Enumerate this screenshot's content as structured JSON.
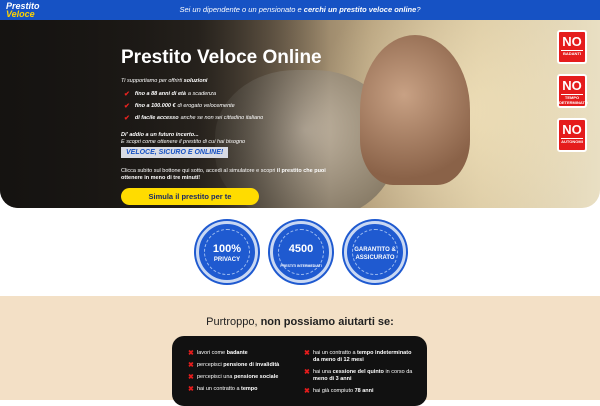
{
  "topbar": {
    "logo_line1": "Prestito",
    "logo_line2": "Veloce",
    "pre": "Sei un dipendente o un pensionato e ",
    "bold": "cerchi un prestito veloce online",
    "post": "?"
  },
  "hero": {
    "title": "Prestito Veloce Online",
    "intro_pre": "Ti supportiamo per offrirti ",
    "intro_bold": "soluzioni",
    "items": [
      {
        "bold": "fino a 88 anni di età",
        "rest": "a scadenza"
      },
      {
        "bold": "fino a 100.000 €",
        "rest": "di erogato velocemente"
      },
      {
        "bold": "di facile accesso",
        "rest": "anche se non sei cittadino italiano"
      }
    ],
    "question": "Di' addio a un futuro incerto...",
    "question2": "E scopri come ottenere il prestito di cui hai bisogno",
    "tagline": "VELOCE, SICURO E ONLINE!",
    "para_pre": "Clicca subito sul bottone qui sotto, accedi al simulatore e scopri ",
    "para_bold": "il prestito che puoi ottenere in meno di tre minuti!",
    "cta_pre": "Simula ",
    "cta_bold": "il prestito per te",
    "scroll_icon": "chevron-down-icon"
  },
  "side_badges": [
    {
      "big": "NO",
      "small": "BADANTI"
    },
    {
      "big": "NO",
      "small": "TEMPO DETERMINATO"
    },
    {
      "big": "NO",
      "small": "AUTONOMI"
    }
  ],
  "seals": [
    {
      "line1": "100%",
      "line2": "PRIVACY"
    },
    {
      "line1": "4500",
      "line2": "PRESTITI INTERMEDIATI"
    },
    {
      "line1": "GARANTITO & ASSICURATO"
    }
  ],
  "lower": {
    "title_pre": "Purtroppo, ",
    "title_bold": "non possiamo aiutarti se:",
    "left": [
      {
        "pre": "lavori come ",
        "bold": "badante",
        "post": ""
      },
      {
        "pre": "percepisci ",
        "bold": "pensione di invalidità",
        "post": ""
      },
      {
        "pre": "percepisci una ",
        "bold": "pensione sociale",
        "post": ""
      },
      {
        "pre": "hai un contratto a ",
        "bold": "tempo",
        "post": ""
      }
    ],
    "right": [
      {
        "pre": "hai un contratto a ",
        "bold": "tempo indeterminato da meno di 12 mesi",
        "post": ""
      },
      {
        "pre": "hai una ",
        "bold": "cessione del quinto",
        "post": " in corso da ",
        "bold2": "meno di 3 anni"
      },
      {
        "pre": "hai già compiuto ",
        "bold": "78 anni",
        "post": ""
      }
    ]
  },
  "colors": {
    "brand_blue": "#1652c4",
    "accent_yellow": "#ffdc00",
    "alert_red": "#e51c1c",
    "cream": "#f3e0c6"
  }
}
